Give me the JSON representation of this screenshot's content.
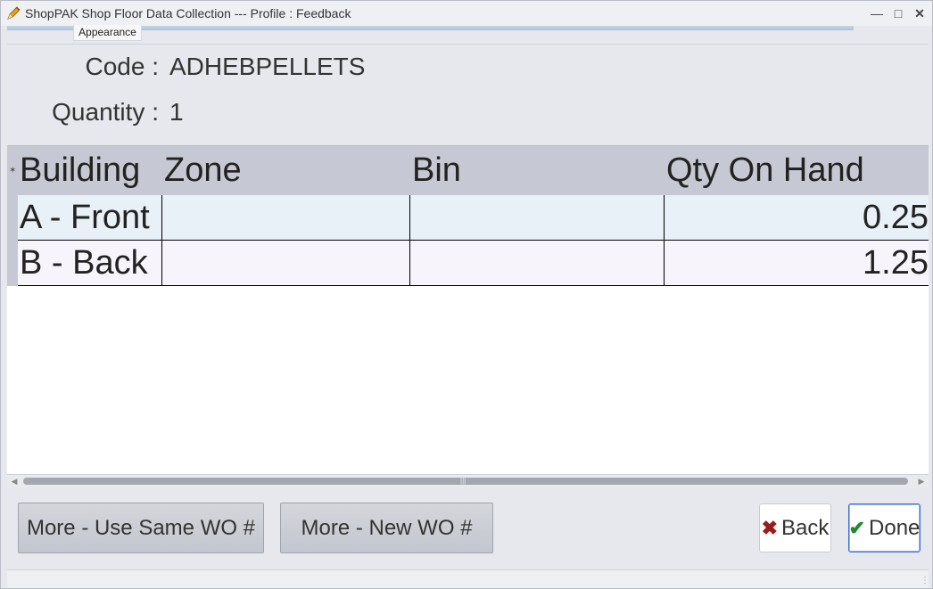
{
  "window": {
    "title": "ShopPAK Shop Floor Data Collection --- Profile : Feedback",
    "appearance_tab": "Appearance"
  },
  "header": {
    "code_label": "Code :",
    "code_value": "ADHEBPELLETS",
    "quantity_label": "Quantity :",
    "quantity_value": "1"
  },
  "grid": {
    "columns": [
      "Building",
      "Zone",
      "Bin",
      "Qty On Hand"
    ],
    "rows": [
      {
        "building": "A - Front",
        "zone": "",
        "bin": "",
        "qty": "0.25"
      },
      {
        "building": "B - Back",
        "zone": "",
        "bin": "",
        "qty": "1.25"
      }
    ]
  },
  "buttons": {
    "more_same": "More - Use Same WO #",
    "more_new": "More - New WO #",
    "back": "Back",
    "done": "Done"
  },
  "icons": {
    "app": "pencil-icon",
    "back": "x-icon",
    "done": "check-icon"
  }
}
